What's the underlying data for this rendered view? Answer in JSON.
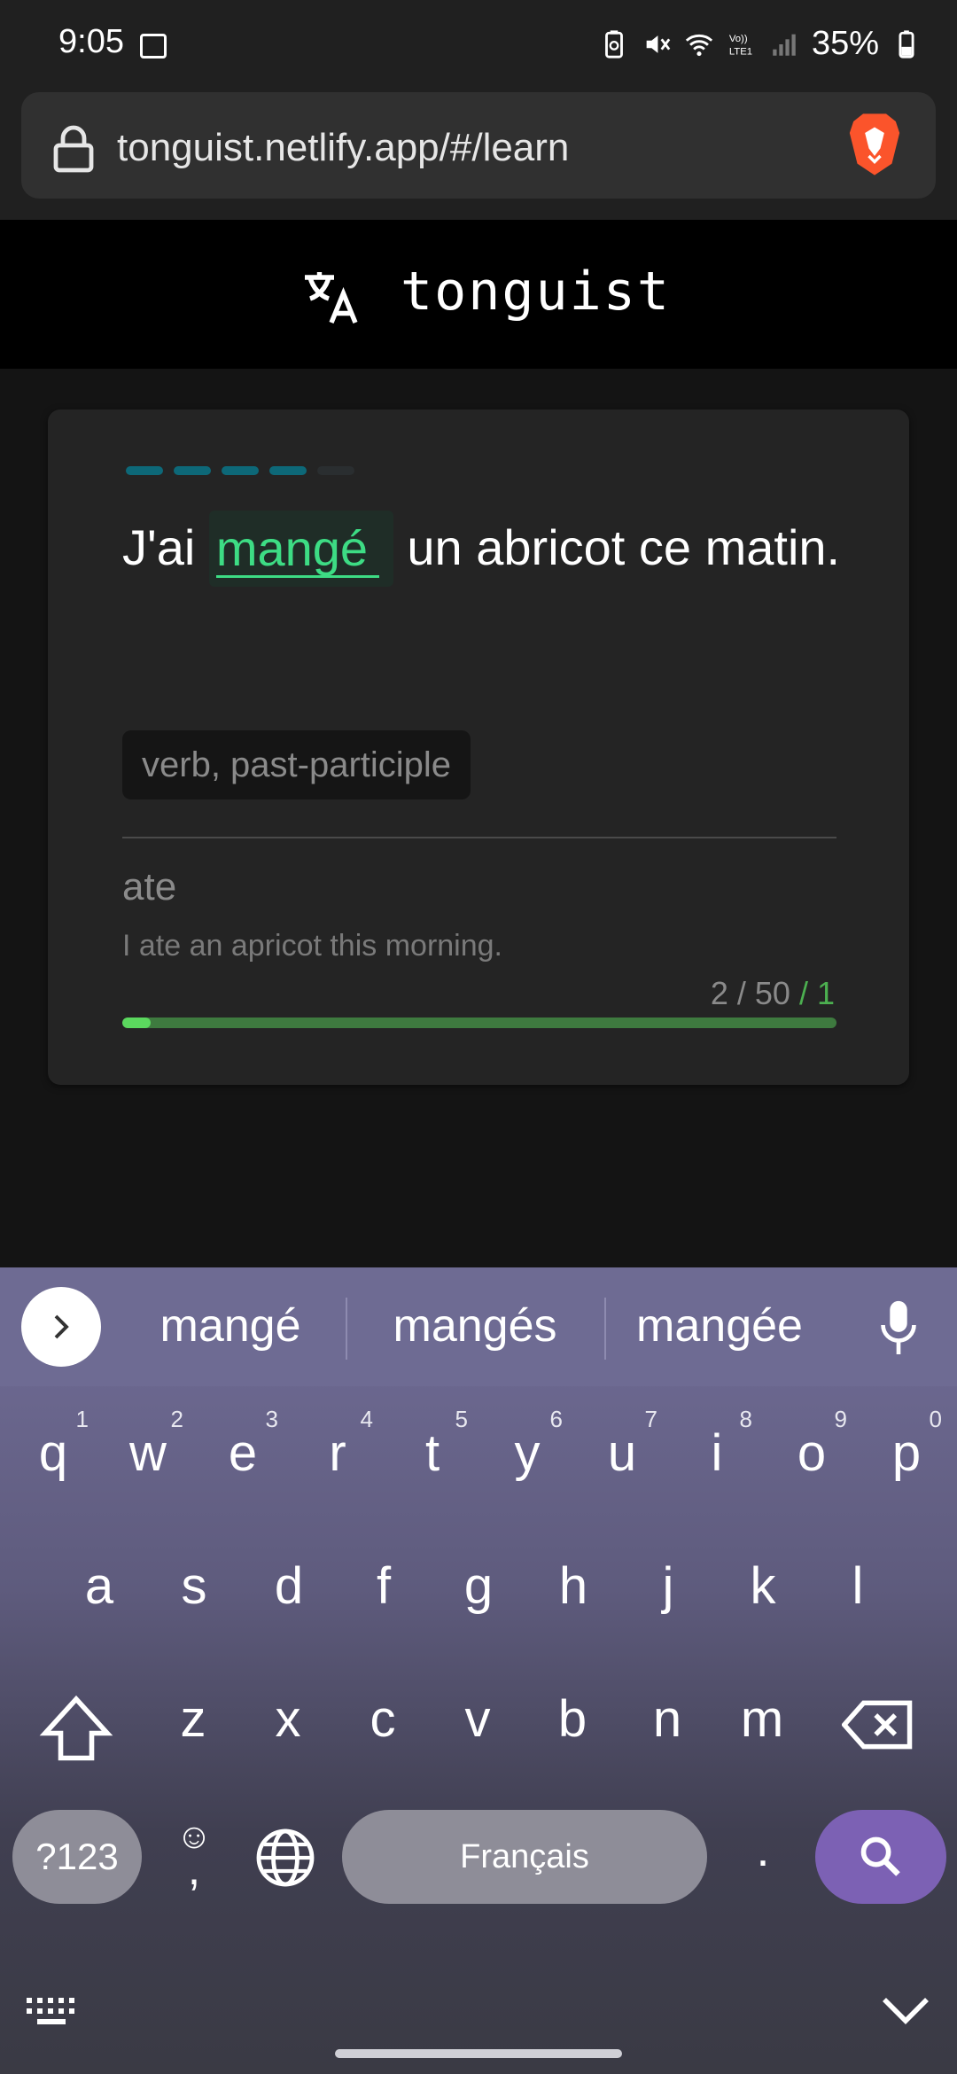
{
  "status": {
    "time": "9:05",
    "battery": "35%",
    "network_label": "VoLTE1"
  },
  "browser": {
    "url": "tonguist.netlify.app/#/learn"
  },
  "app": {
    "title": "tonguist"
  },
  "card": {
    "progress_dashes": {
      "filled": 4,
      "total": 5
    },
    "sentence_before": "J'ai",
    "answer_value": "mangé",
    "sentence_after": "un abricot ce matin.",
    "pos_tag": "verb, past-participle",
    "translation": "ate",
    "example": "I ate an apricot this morning.",
    "counter_main": "2 / 50",
    "counter_sep": " / ",
    "counter_correct": "1",
    "progress_fraction": 0.04
  },
  "keyboard": {
    "suggestions": [
      "mangé",
      "mangés",
      "mangée"
    ],
    "row1": [
      {
        "k": "q",
        "n": "1"
      },
      {
        "k": "w",
        "n": "2"
      },
      {
        "k": "e",
        "n": "3"
      },
      {
        "k": "r",
        "n": "4"
      },
      {
        "k": "t",
        "n": "5"
      },
      {
        "k": "y",
        "n": "6"
      },
      {
        "k": "u",
        "n": "7"
      },
      {
        "k": "i",
        "n": "8"
      },
      {
        "k": "o",
        "n": "9"
      },
      {
        "k": "p",
        "n": "0"
      }
    ],
    "row2": [
      "a",
      "s",
      "d",
      "f",
      "g",
      "h",
      "j",
      "k",
      "l"
    ],
    "row3": [
      "z",
      "x",
      "c",
      "v",
      "b",
      "n",
      "m"
    ],
    "symbols_label": "?123",
    "space_label": "Français",
    "period_label": ".",
    "emoji_label": "☺",
    "comma_label": ","
  }
}
